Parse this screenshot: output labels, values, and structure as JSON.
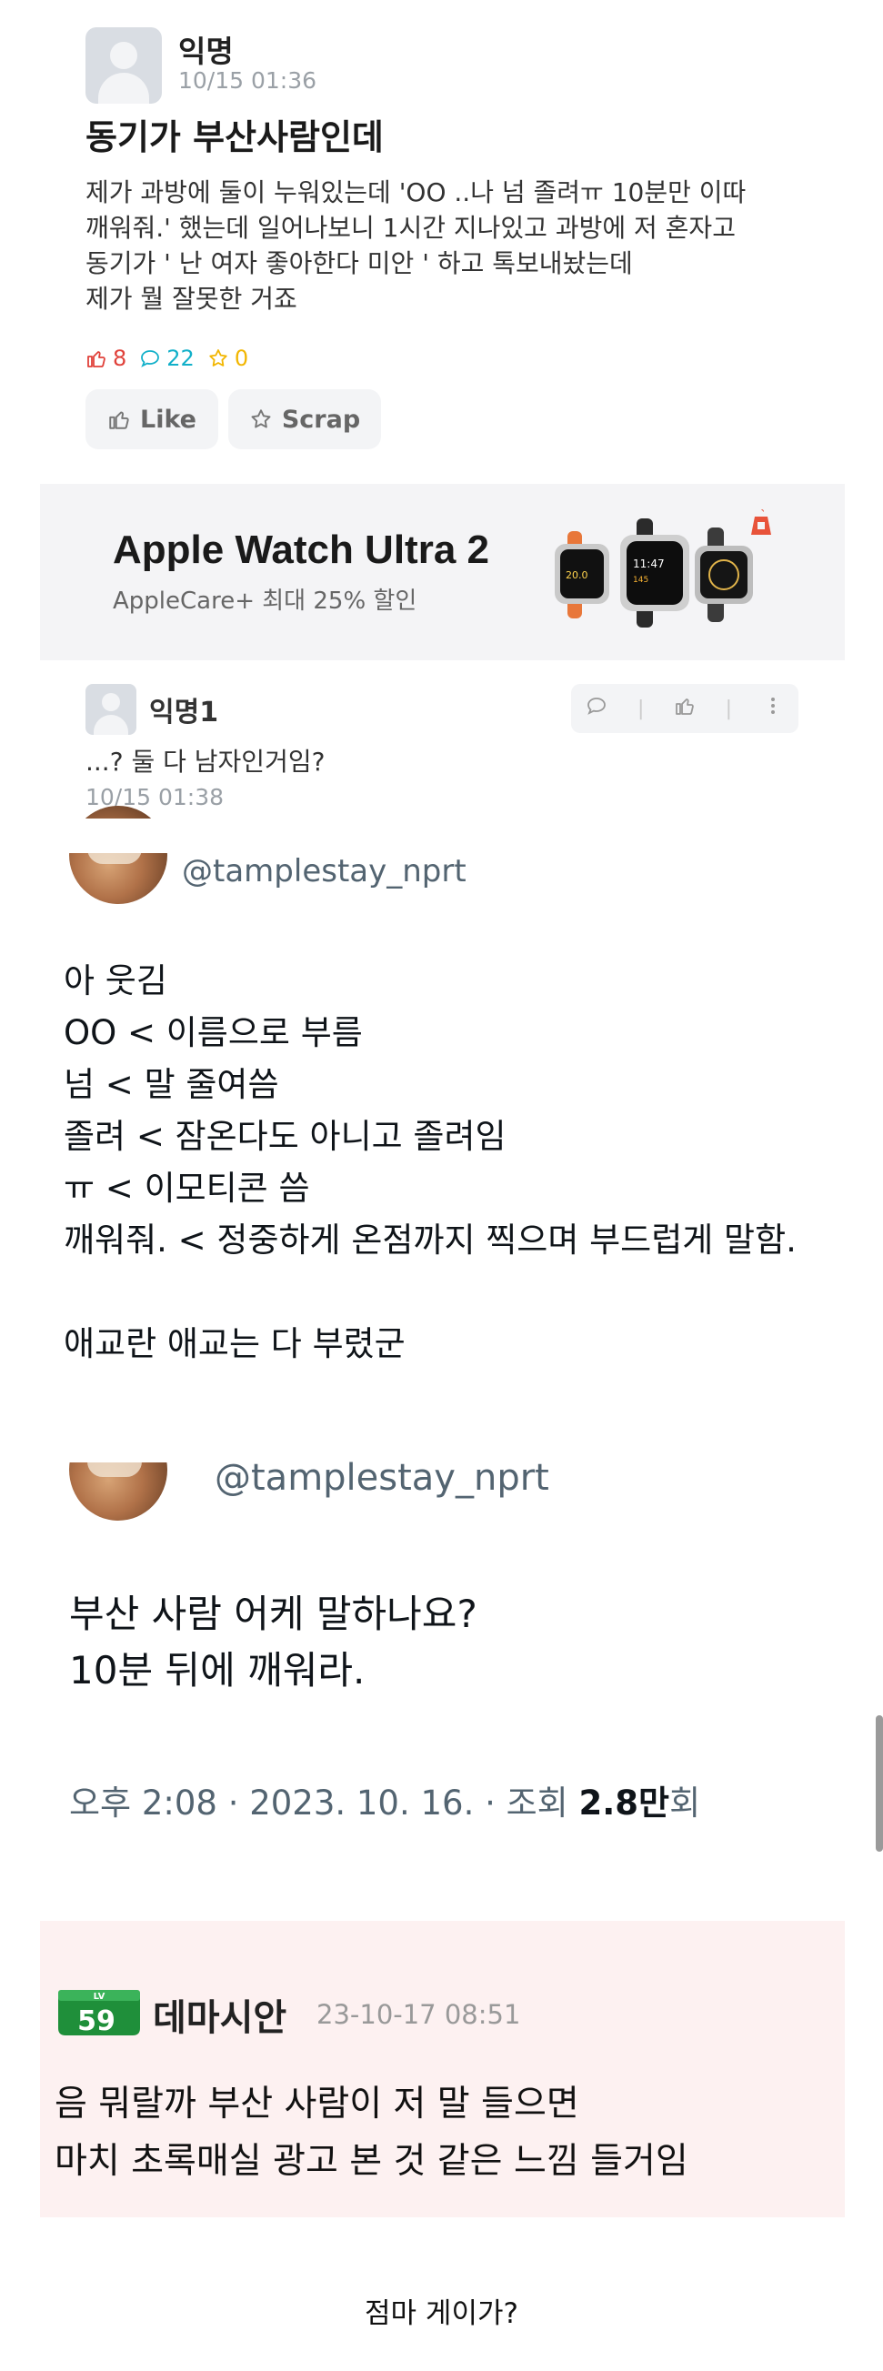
{
  "post": {
    "author": "익명",
    "time": "10/15 01:36",
    "title": "동기가 부산사람인데",
    "body": "제가 과방에 둘이 누워있는데 'OO ..나 넘 졸려ㅠ 10분만 이따\n깨워줘.' 했는데 일어나보니 1시간 지나있고 과방에 저 혼자고\n동기가 ' 난 여자 좋아한다 미안 ' 하고 톡보내놨는데\n제가 뭘 잘못한 거죠",
    "likes": "8",
    "comments": "22",
    "scraps": "0",
    "like_label": "Like",
    "scrap_label": "Scrap"
  },
  "ad": {
    "title": "Apple Watch Ultra 2",
    "subtitle": "AppleCare+ 최대 25% 할인"
  },
  "comment": {
    "author": "익명1",
    "text": "...? 둘 다 남자인거임?",
    "time": "10/15 01:38"
  },
  "tweet1": {
    "handle": "@tamplestay_nprt",
    "body": "아 웃김\nOO < 이름으로 부름\n넘 < 말 줄여씀\n졸려 < 잠온다도 아니고 졸려임\nㅠ < 이모티콘 씀\n깨워줘. < 정중하게 온점까지 찍으며 부드럽게 말함.\n\n애교란 애교는 다 부렸군"
  },
  "tweet2": {
    "handle": "@tamplestay_nprt",
    "body": "부산 사람 어케 말하나요?\n10분 뒤에 깨워라.",
    "meta_prefix": "오후 2:08 · 2023. 10. 16. · 조회 ",
    "meta_views": "2.8만",
    "meta_suffix": "회"
  },
  "reply": {
    "level_top": "LV",
    "level": "59",
    "author": "데마시안",
    "time": "23-10-17 08:51",
    "text": "음 뭐랄까 부산 사람이 저 말 들으면\n마치 초록매실 광고 본 것 같은 느낌 들거임"
  },
  "footer": {
    "text": "점마 게이가?"
  },
  "colors": {
    "like": "#e0413a",
    "comment": "#12b0c9",
    "scrap": "#f2b600",
    "level_badge": "#1f8f3a"
  }
}
